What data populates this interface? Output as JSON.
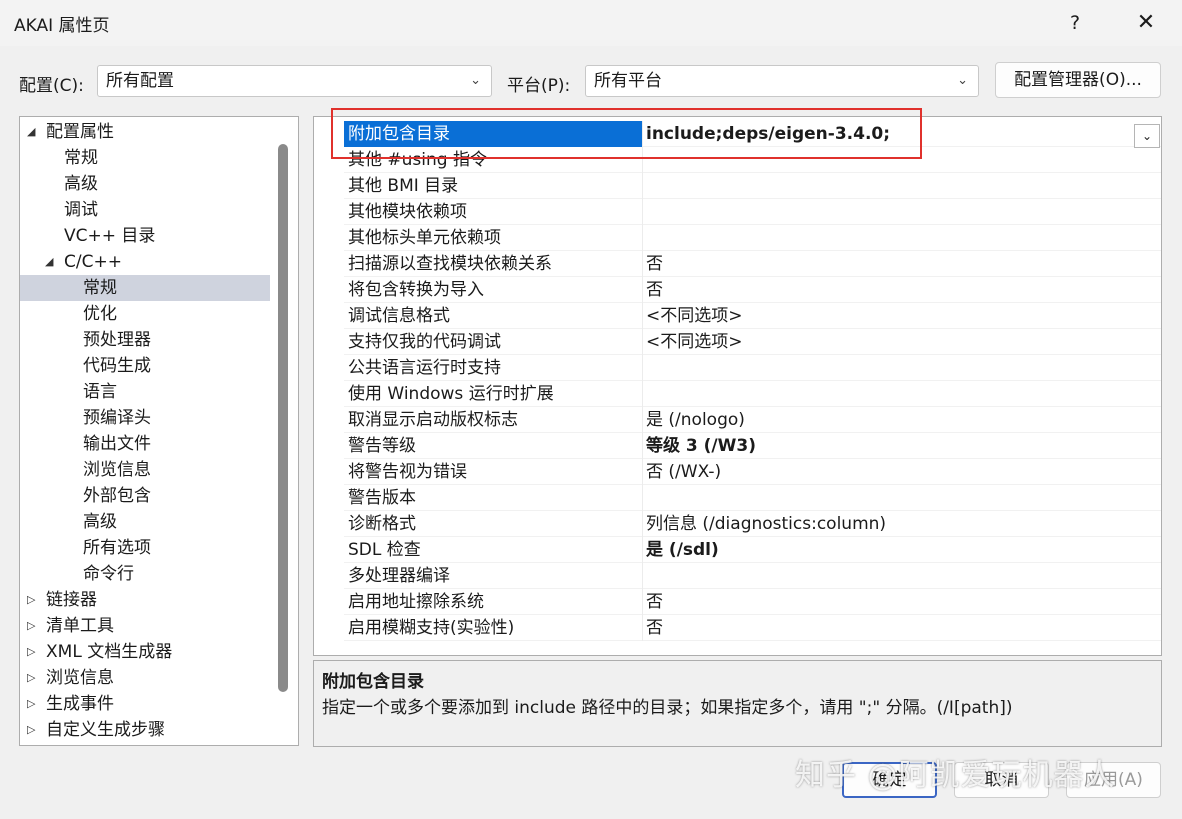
{
  "window": {
    "title": "AKAI 属性页",
    "help_label": "?",
    "close_label": "✕"
  },
  "config": {
    "label": "配置(C):",
    "value": "所有配置"
  },
  "platform": {
    "label": "平台(P):",
    "value": "所有平台"
  },
  "config_manager_label": "配置管理器(O)...",
  "tree": [
    {
      "label": "配置属性",
      "level": 0,
      "state": "expanded"
    },
    {
      "label": "常规",
      "level": 1
    },
    {
      "label": "高级",
      "level": 1
    },
    {
      "label": "调试",
      "level": 1
    },
    {
      "label": "VC++ 目录",
      "level": 1
    },
    {
      "label": "C/C++",
      "level": 1,
      "state": "expanded"
    },
    {
      "label": "常规",
      "level": 2,
      "selected": true
    },
    {
      "label": "优化",
      "level": 2
    },
    {
      "label": "预处理器",
      "level": 2
    },
    {
      "label": "代码生成",
      "level": 2
    },
    {
      "label": "语言",
      "level": 2
    },
    {
      "label": "预编译头",
      "level": 2
    },
    {
      "label": "输出文件",
      "level": 2
    },
    {
      "label": "浏览信息",
      "level": 2
    },
    {
      "label": "外部包含",
      "level": 2
    },
    {
      "label": "高级",
      "level": 2
    },
    {
      "label": "所有选项",
      "level": 2
    },
    {
      "label": "命令行",
      "level": 2
    },
    {
      "label": "链接器",
      "level": 0,
      "state": "collapsed"
    },
    {
      "label": "清单工具",
      "level": 0,
      "state": "collapsed"
    },
    {
      "label": "XML 文档生成器",
      "level": 0,
      "state": "collapsed"
    },
    {
      "label": "浏览信息",
      "level": 0,
      "state": "collapsed"
    },
    {
      "label": "生成事件",
      "level": 0,
      "state": "collapsed"
    },
    {
      "label": "自定义生成步骤",
      "level": 0,
      "state": "collapsed"
    }
  ],
  "properties": [
    {
      "name": "附加包含目录",
      "value": "include;deps/eigen-3.4.0;",
      "bold": true,
      "selected": true
    },
    {
      "name": "其他 #using 指令",
      "value": ""
    },
    {
      "name": "其他 BMI 目录",
      "value": ""
    },
    {
      "name": "其他模块依赖项",
      "value": ""
    },
    {
      "name": "其他标头单元依赖项",
      "value": ""
    },
    {
      "name": "扫描源以查找模块依赖关系",
      "value": "否"
    },
    {
      "name": "将包含转换为导入",
      "value": "否"
    },
    {
      "name": "调试信息格式",
      "value": "<不同选项>"
    },
    {
      "name": "支持仅我的代码调试",
      "value": "<不同选项>"
    },
    {
      "name": "公共语言运行时支持",
      "value": ""
    },
    {
      "name": "使用 Windows 运行时扩展",
      "value": ""
    },
    {
      "name": "取消显示启动版权标志",
      "value": "是 (/nologo)"
    },
    {
      "name": "警告等级",
      "value": "等级 3 (/W3)",
      "bold": true
    },
    {
      "name": "将警告视为错误",
      "value": "否 (/WX-)"
    },
    {
      "name": "警告版本",
      "value": ""
    },
    {
      "name": "诊断格式",
      "value": "列信息 (/diagnostics:column)"
    },
    {
      "name": "SDL 检查",
      "value": "是 (/sdl)",
      "bold": true
    },
    {
      "name": "多处理器编译",
      "value": ""
    },
    {
      "name": "启用地址擦除系统",
      "value": "否"
    },
    {
      "name": "启用模糊支持(实验性)",
      "value": "否"
    }
  ],
  "description": {
    "title": "附加包含目录",
    "text": "指定一个或多个要添加到 include 路径中的目录；如果指定多个，请用 \";\" 分隔。(/I[path])"
  },
  "buttons": {
    "ok": "确定",
    "cancel": "取消",
    "apply": "应用(A)"
  },
  "watermark": "知乎 @阿凯爱玩机器人",
  "colors": {
    "selection": "#0a6fd6",
    "tree_selection": "#cfd3de",
    "highlight_box": "#e0312c",
    "accent": "#3b66c4"
  }
}
